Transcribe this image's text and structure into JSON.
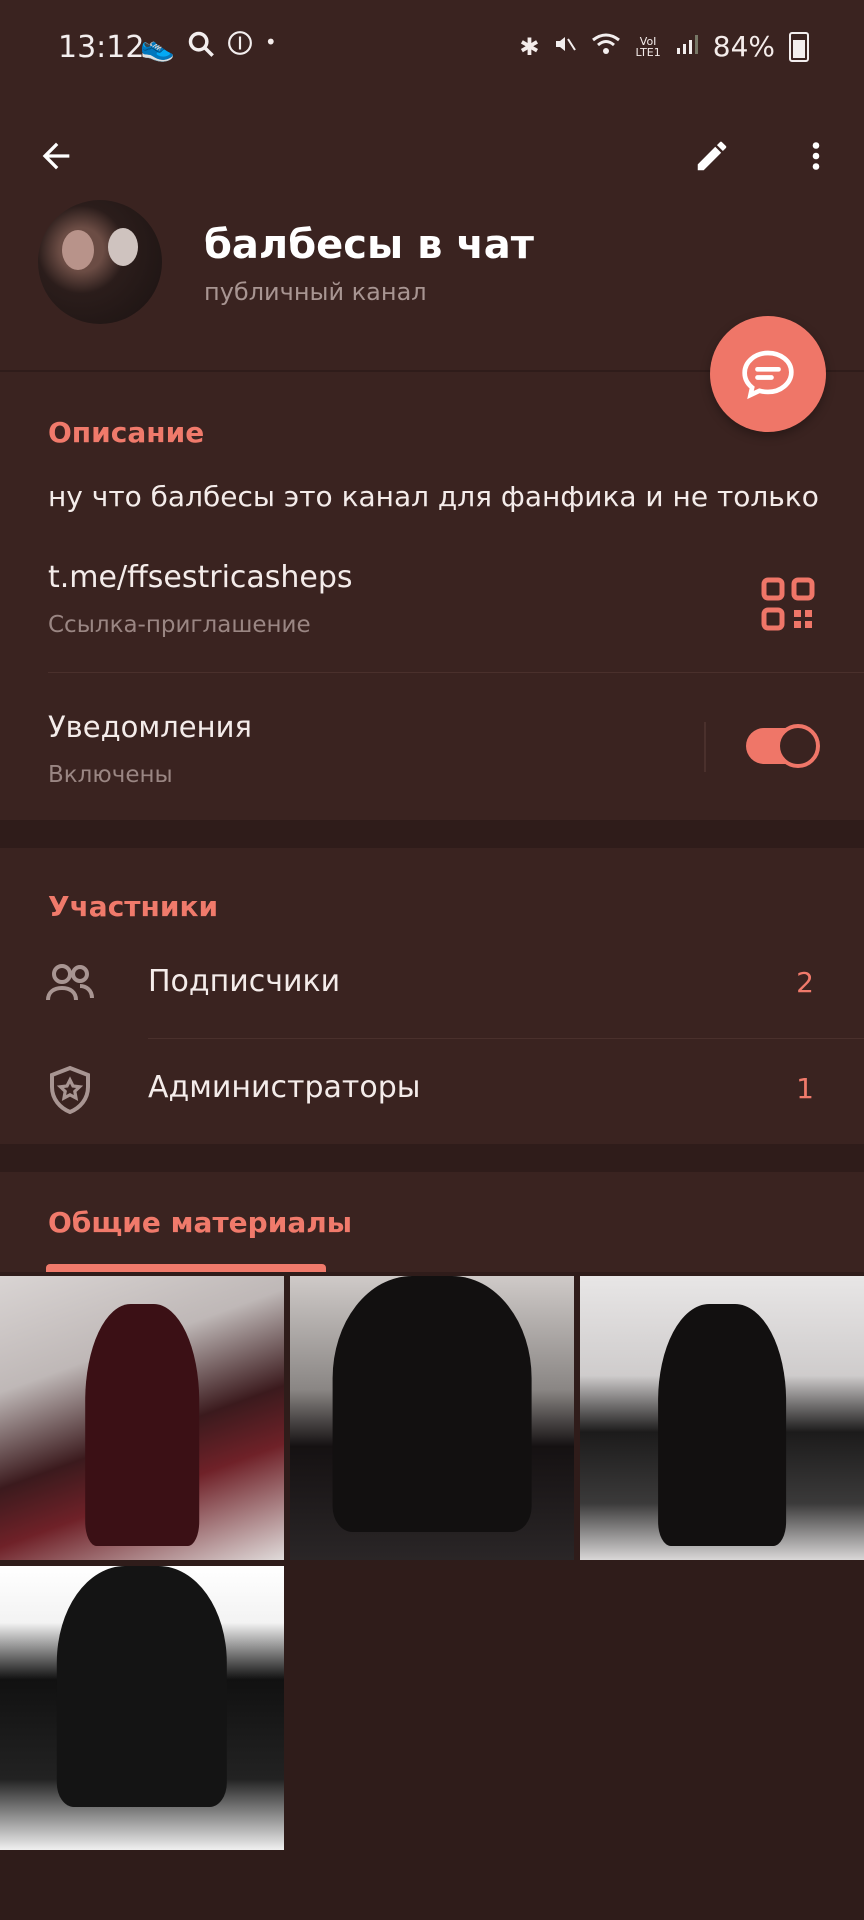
{
  "status_bar": {
    "time": "13:12",
    "battery": "84%",
    "left_icons": [
      "shoe-icon",
      "search-icon",
      "food-icon",
      "dot-icon"
    ],
    "right_icons": [
      "bluetooth-icon",
      "mute-icon",
      "wifi-icon",
      "volte-icon",
      "signal-icon"
    ]
  },
  "header": {
    "title": "балбесы в чат",
    "subtitle": "публичный канал"
  },
  "info": {
    "section_title": "Описание",
    "description": "ну что балбесы это канал для фанфика и не только",
    "link": "t.me/ffsestricasheps",
    "link_sub": "Ссылка-приглашение",
    "notifications_label": "Уведомления",
    "notifications_status": "Включены",
    "notifications_on": true
  },
  "members": {
    "section_title": "Участники",
    "rows": [
      {
        "label": "Подписчики",
        "count": "2",
        "icon": "people-icon"
      },
      {
        "label": "Администраторы",
        "count": "1",
        "icon": "shield-star-icon"
      }
    ]
  },
  "media": {
    "tab_label": "Общие материалы"
  },
  "colors": {
    "accent": "#ef7668",
    "background": "#2f1c1a",
    "surface": "#3a2320"
  }
}
